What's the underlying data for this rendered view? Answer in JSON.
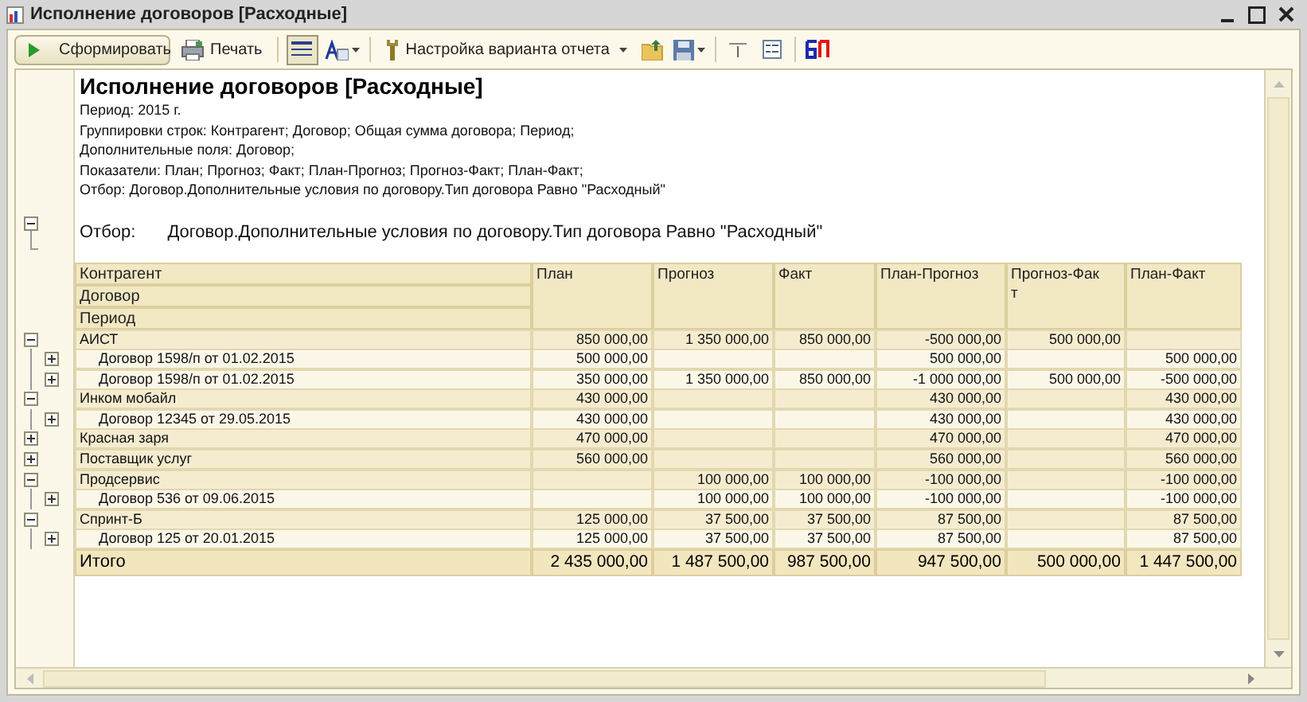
{
  "window": {
    "title": "Исполнение договоров [Расходные]"
  },
  "toolbar": [
    {
      "kind": "primary",
      "label": "Сформировать"
    },
    {
      "kind": "print",
      "label": "Печать"
    },
    {
      "kind": "separator"
    },
    {
      "kind": "grid",
      "pressed": true
    },
    {
      "kind": "font",
      "dropdown": true
    },
    {
      "kind": "separator"
    },
    {
      "kind": "settings",
      "label": "Настройка варианта отчета",
      "dropdown": true
    },
    {
      "kind": "open"
    },
    {
      "kind": "save",
      "dropdown": true
    },
    {
      "kind": "separator"
    },
    {
      "kind": "columns"
    },
    {
      "kind": "form"
    },
    {
      "kind": "separator"
    },
    {
      "kind": "logo"
    }
  ],
  "report": {
    "title": "Исполнение договоров [Расходные]",
    "info_lines": [
      "Период: 2015 г.",
      "Группировки строк: Контрагент; Договор; Общая сумма договора; Период;",
      "Дополнительные поля: Договор;",
      "Показатели: План; Прогноз; Факт; План-Прогноз; Прогноз-Факт; План-Факт;",
      "Отбор: Договор.Дополнительные условия по договору.Тип договора Равно \"Расходный\""
    ],
    "filter": {
      "expanded": true,
      "label": "Отбор:",
      "text": "Договор.Дополнительные условия по договору.Тип договора Равно \"Расходный\""
    }
  },
  "table": {
    "group_headers": [
      "Контрагент",
      "Договор",
      "Период"
    ],
    "columns": [
      "План",
      "Прогноз",
      "Факт",
      "План-Прогноз",
      "Прогноз-Фак\nт",
      "План-Факт"
    ],
    "rows": [
      {
        "kind": "group",
        "label": "АИСТ",
        "expanded": true,
        "values": {
          "plan": "850 000,00",
          "forecast": "1 350 000,00",
          "fact": "850 000,00",
          "plan_forecast": "-500 000,00",
          "forecast_fact": "500 000,00"
        }
      },
      {
        "kind": "contract",
        "label": "Договор 1598/п от 01.02.2015",
        "expanded": false,
        "values": {
          "plan": "500 000,00",
          "plan_forecast": "500 000,00",
          "plan_fact": "500 000,00"
        }
      },
      {
        "kind": "contract",
        "label": "Договор 1598/п от 01.02.2015",
        "expanded": false,
        "values": {
          "plan": "350 000,00",
          "forecast": "1 350 000,00",
          "fact": "850 000,00",
          "plan_forecast": "-1 000 000,00",
          "forecast_fact": "500 000,00",
          "plan_fact": "-500 000,00"
        }
      },
      {
        "kind": "group",
        "label": "Инком мобайл",
        "expanded": true,
        "values": {
          "plan": "430 000,00",
          "plan_forecast": "430 000,00",
          "plan_fact": "430 000,00"
        }
      },
      {
        "kind": "contract",
        "label": "Договор 12345 от 29.05.2015",
        "expanded": false,
        "values": {
          "plan": "430 000,00",
          "plan_forecast": "430 000,00",
          "plan_fact": "430 000,00"
        }
      },
      {
        "kind": "group",
        "label": "Красная заря",
        "expanded": false,
        "values": {
          "plan": "470 000,00",
          "plan_forecast": "470 000,00",
          "plan_fact": "470 000,00"
        }
      },
      {
        "kind": "group",
        "label": "Поставщик услуг",
        "expanded": false,
        "values": {
          "plan": "560 000,00",
          "plan_forecast": "560 000,00",
          "plan_fact": "560 000,00"
        }
      },
      {
        "kind": "group",
        "label": "Продсервис",
        "expanded": true,
        "values": {
          "forecast": "100 000,00",
          "fact": "100 000,00",
          "plan_forecast": "-100 000,00",
          "plan_fact": "-100 000,00"
        }
      },
      {
        "kind": "contract",
        "label": "Договор 536 от 09.06.2015",
        "expanded": false,
        "values": {
          "forecast": "100 000,00",
          "fact": "100 000,00",
          "plan_forecast": "-100 000,00",
          "plan_fact": "-100 000,00"
        }
      },
      {
        "kind": "group",
        "label": "Спринт-Б",
        "expanded": true,
        "values": {
          "plan": "125 000,00",
          "forecast": "37 500,00",
          "fact": "37 500,00",
          "plan_forecast": "87 500,00",
          "plan_fact": "87 500,00"
        }
      },
      {
        "kind": "contract",
        "label": "Договор 125 от 20.01.2015",
        "expanded": false,
        "values": {
          "plan": "125 000,00",
          "forecast": "37 500,00",
          "fact": "37 500,00",
          "plan_forecast": "87 500,00",
          "plan_fact": "87 500,00"
        }
      }
    ],
    "total": {
      "label": "Итого",
      "values": {
        "plan": "2 435 000,00",
        "forecast": "1 487 500,00",
        "fact": "987 500,00",
        "plan_forecast": "947 500,00",
        "forecast_fact": "500 000,00",
        "plan_fact": "1 447 500,00"
      }
    }
  }
}
